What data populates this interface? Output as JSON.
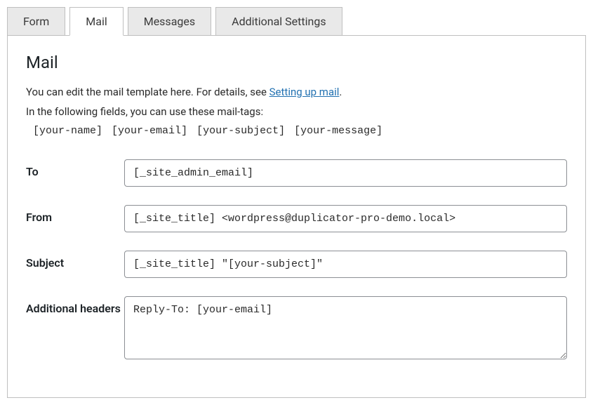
{
  "tabs": {
    "form": "Form",
    "mail": "Mail",
    "messages": "Messages",
    "additional_settings": "Additional Settings"
  },
  "panel": {
    "title": "Mail",
    "intro_line1_prefix": "You can edit the mail template here. For details, see ",
    "intro_link_text": "Setting up mail",
    "intro_line1_suffix": ".",
    "intro_line2": "In the following fields, you can use these mail-tags:",
    "mail_tags": [
      "[your-name]",
      "[your-email]",
      "[your-subject]",
      "[your-message]"
    ]
  },
  "fields": {
    "to": {
      "label": "To",
      "value": "[_site_admin_email]"
    },
    "from": {
      "label": "From",
      "value": "[_site_title] <wordpress@duplicator-pro-demo.local>"
    },
    "subject": {
      "label": "Subject",
      "value": "[_site_title] \"[your-subject]\""
    },
    "additional_headers": {
      "label": "Additional headers",
      "value": "Reply-To: [your-email]"
    }
  }
}
